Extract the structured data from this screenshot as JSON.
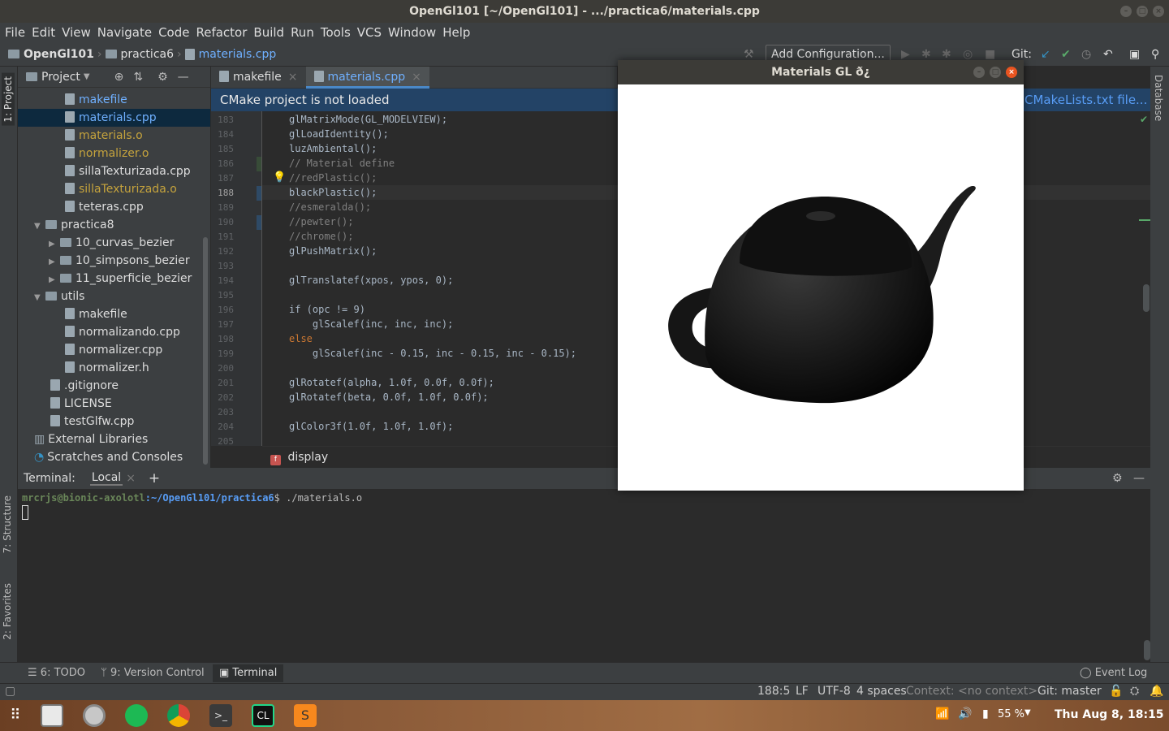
{
  "window": {
    "title": "OpenGl101 [~/OpenGl101] - .../practica6/materials.cpp"
  },
  "menu": [
    "File",
    "Edit",
    "View",
    "Navigate",
    "Code",
    "Refactor",
    "Build",
    "Run",
    "Tools",
    "VCS",
    "Window",
    "Help"
  ],
  "breadcrumb": {
    "project": "OpenGl101",
    "folder": "practica6",
    "file": "materials.cpp"
  },
  "toolbar": {
    "config_label": "Add Configuration...",
    "git_label": "Git:"
  },
  "project_panel": {
    "title": "Project"
  },
  "tree": [
    {
      "label": "makefile",
      "color": "#6fb0ff"
    },
    {
      "label": "materials.cpp",
      "color": "#6fb0ff"
    },
    {
      "label": "materials.o",
      "color": "#c5a33d"
    },
    {
      "label": "normalizer.o",
      "color": "#c5a33d"
    },
    {
      "label": "sillaTexturizada.cpp",
      "color": "#ddd"
    },
    {
      "label": "sillaTexturizada.o",
      "color": "#c5a33d"
    },
    {
      "label": "teteras.cpp",
      "color": "#ddd"
    },
    {
      "label": "practica8",
      "color": "#ddd"
    },
    {
      "label": "10_curvas_bezier",
      "color": "#ddd"
    },
    {
      "label": "10_simpsons_bezier",
      "color": "#ddd"
    },
    {
      "label": "11_superficie_bezier",
      "color": "#ddd"
    },
    {
      "label": "utils",
      "color": "#ddd"
    },
    {
      "label": "makefile",
      "color": "#ddd"
    },
    {
      "label": "normalizando.cpp",
      "color": "#ddd"
    },
    {
      "label": "normalizer.cpp",
      "color": "#ddd"
    },
    {
      "label": "normalizer.h",
      "color": "#ddd"
    },
    {
      "label": ".gitignore",
      "color": "#ddd"
    },
    {
      "label": "LICENSE",
      "color": "#ddd"
    },
    {
      "label": "testGlfw.cpp",
      "color": "#ddd"
    },
    {
      "label": "External Libraries",
      "color": "#ddd"
    },
    {
      "label": "Scratches and Consoles",
      "color": "#ddd"
    }
  ],
  "editor_tabs": [
    "makefile",
    "materials.cpp"
  ],
  "banner": {
    "message": "CMake project is not loaded",
    "link": "CMakeLists.txt file..."
  },
  "code": [
    {
      "n": "183",
      "t": "glMatrixMode(GL_MODELVIEW);"
    },
    {
      "n": "184",
      "t": "glLoadIdentity();"
    },
    {
      "n": "185",
      "t": "luzAmbiental();"
    },
    {
      "n": "186",
      "t": "// Material define"
    },
    {
      "n": "187",
      "t": "//redPlastic();"
    },
    {
      "n": "188",
      "t": "blackPlastic();"
    },
    {
      "n": "189",
      "t": "//esmeralda();"
    },
    {
      "n": "190",
      "t": "//pewter();"
    },
    {
      "n": "191",
      "t": "//chrome();"
    },
    {
      "n": "192",
      "t": "glPushMatrix();"
    },
    {
      "n": "193",
      "t": ""
    },
    {
      "n": "194",
      "t": "glTranslatef(xpos, ypos, 0);"
    },
    {
      "n": "195",
      "t": ""
    },
    {
      "n": "196",
      "t": "if (opc != 9)"
    },
    {
      "n": "197",
      "t": "    glScalef(inc, inc, inc);"
    },
    {
      "n": "198",
      "t": "else"
    },
    {
      "n": "199",
      "t": "    glScalef(inc - 0.15, inc - 0.15, inc - 0.15);"
    },
    {
      "n": "200",
      "t": ""
    },
    {
      "n": "201",
      "t": "glRotatef(alpha, 1.0f, 0.0f, 0.0f);"
    },
    {
      "n": "202",
      "t": "glRotatef(beta, 0.0f, 1.0f, 0.0f);"
    },
    {
      "n": "203",
      "t": ""
    },
    {
      "n": "204",
      "t": "glColor3f(1.0f, 1.0f, 1.0f);"
    },
    {
      "n": "205",
      "t": ""
    }
  ],
  "code_breadcrumb": "display",
  "terminal": {
    "label": "Terminal:",
    "tab": "Local",
    "prompt_user": "mrcrjs@bionic-axolotl",
    "prompt_path": ":~/OpenGl101/practica6",
    "prompt_cmd": "$ ./materials.o"
  },
  "tool_windows": [
    "6: TODO",
    "9: Version Control",
    "Terminal",
    "Event Log"
  ],
  "left_strip": [
    "1: Project",
    "7: Structure",
    "2: Favorites"
  ],
  "right_strip": [
    "Database"
  ],
  "status": {
    "position": "188:5",
    "line_sep": "LF",
    "encoding": "UTF-8",
    "indent": "4 spaces",
    "context": "Context: <no context>",
    "git": "Git: master"
  },
  "gl_window": {
    "title": "Materials GL ð¿"
  },
  "taskbar": {
    "battery": "55 %",
    "clock": "Thu Aug  8, 18:15"
  }
}
